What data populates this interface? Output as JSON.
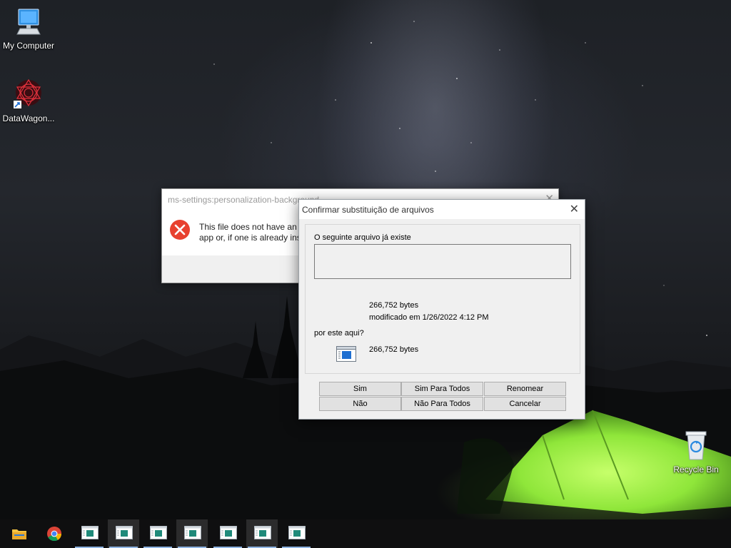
{
  "desktop": {
    "icons": [
      {
        "label": "My Computer"
      },
      {
        "label": "DataWagon..."
      },
      {
        "label": "Recycle Bin"
      }
    ]
  },
  "error_dialog": {
    "title": "ms-settings:personalization-background",
    "message_line1": "This file does not have an a",
    "message_line2": "app or, if one is already ins",
    "close_glyph": "✕"
  },
  "confirm_dialog": {
    "title": "Confirmar substituição de arquivos",
    "close_glyph": "✕",
    "existing_label": "O seguinte arquivo já existe",
    "existing_size": "266,752 bytes",
    "existing_modified": "modificado em 1/26/2022 4:12 PM",
    "replace_label": "por este aqui?",
    "new_size": "266,752 bytes",
    "buttons": {
      "yes": "Sim",
      "yes_all": "Sim Para Todos",
      "rename": "Renomear",
      "no": "Não",
      "no_all": "Não Para Todos",
      "cancel": "Cancelar"
    }
  },
  "taskbar": {
    "items": [
      {
        "icon": "file-explorer-icon"
      },
      {
        "icon": "chrome-icon"
      },
      {
        "icon": "app-window-icon"
      },
      {
        "icon": "app-window-icon"
      },
      {
        "icon": "app-window-icon"
      },
      {
        "icon": "app-window-icon"
      },
      {
        "icon": "app-window-icon"
      },
      {
        "icon": "app-window-icon"
      },
      {
        "icon": "app-window-icon"
      }
    ],
    "accent_color": "#8fb4e2"
  },
  "colors": {
    "tent": "#8fe63a",
    "error_red": "#e8412f"
  }
}
